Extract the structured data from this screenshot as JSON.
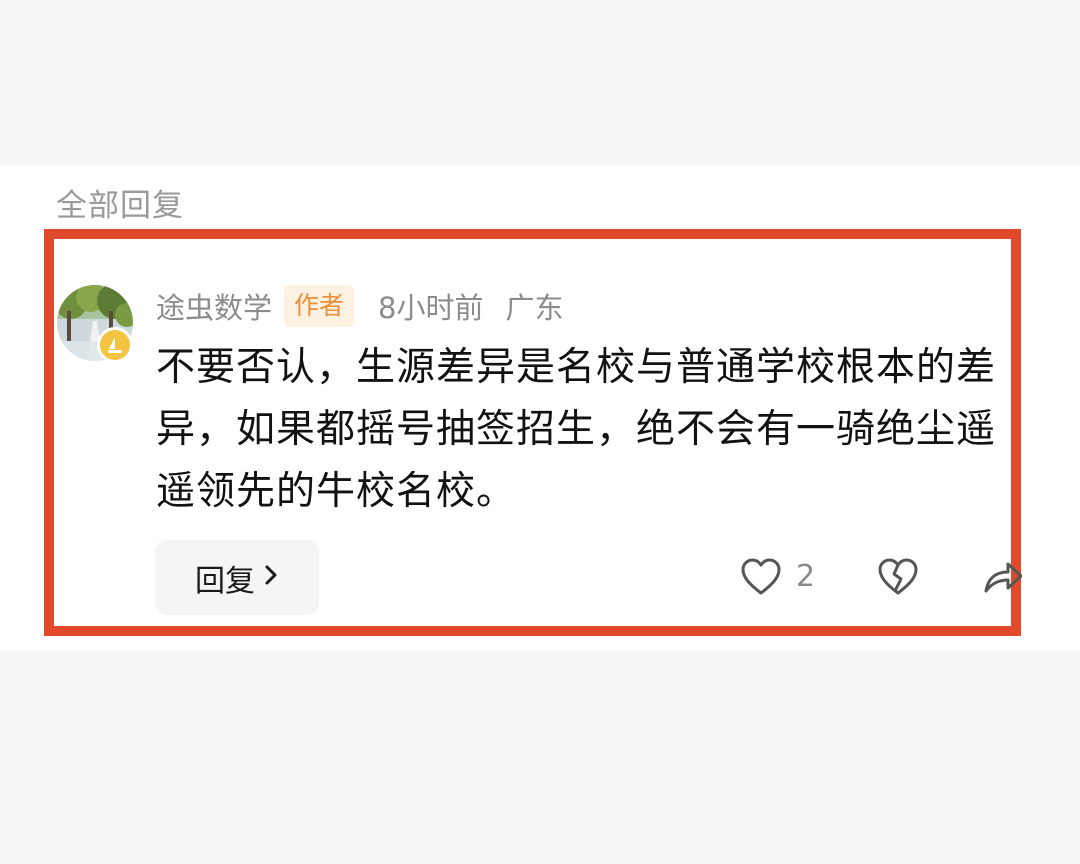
{
  "section": {
    "title": "全部回复"
  },
  "comment": {
    "username": "途虫数学",
    "author_tag": "作者",
    "time": "8小时前",
    "region": "广东",
    "body": "不要否认，生源差异是名校与普通学校根本的差异，如果都摇号抽签招生，绝不会有一骑绝尘遥遥领先的牛校名校。",
    "like_count": "2",
    "reply_label": "回复",
    "avatar_badge_icon": "sailboat-icon"
  },
  "colors": {
    "highlight_border": "#e0492b",
    "author_tag_text": "#e8903a",
    "author_tag_bg": "#fdf1e2",
    "badge": "#f5c443"
  }
}
